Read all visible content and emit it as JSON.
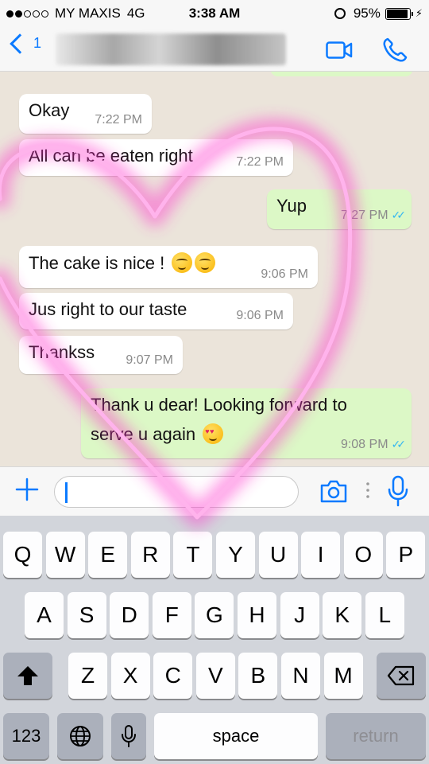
{
  "status_bar": {
    "carrier": "MY MAXIS",
    "network": "4G",
    "time": "3:38 AM",
    "battery_text": "95%",
    "battery_level": 0.95
  },
  "header": {
    "back_count": "1",
    "accent_color": "#0b7aff"
  },
  "messages": [
    {
      "dir": "in",
      "text": "Okay",
      "time": "7:22 PM"
    },
    {
      "dir": "in",
      "text": "All can be eaten right",
      "time": "7:22 PM"
    },
    {
      "dir": "out",
      "text": "Yup",
      "time": "7:27 PM"
    },
    {
      "dir": "in",
      "text": "The cake is nice !",
      "time": "9:06 PM"
    },
    {
      "dir": "in",
      "text": "Jus right to our taste",
      "time": "9:06 PM"
    },
    {
      "dir": "in",
      "text": "Thankss",
      "time": "9:07 PM"
    },
    {
      "dir": "out",
      "text_line1": "Thank u dear! Looking forward to",
      "text_line2": "serve u again",
      "time": "9:08 PM"
    }
  ],
  "icons": {
    "read_receipt": "double-check-icon",
    "emoji_yum": "savoring-food-emoji",
    "emoji_love": "heart-eyes-emoji"
  },
  "colors": {
    "outgoing_bubble": "#dcf8c6",
    "incoming_bubble": "#ffffff",
    "read_tick": "#34b7f1",
    "heart_drawing": "#ff33cc"
  },
  "input_bar": {
    "placeholder": ""
  },
  "keyboard": {
    "row1": [
      "Q",
      "W",
      "E",
      "R",
      "T",
      "Y",
      "U",
      "I",
      "O",
      "P"
    ],
    "row2": [
      "A",
      "S",
      "D",
      "F",
      "G",
      "H",
      "J",
      "K",
      "L"
    ],
    "row3": [
      "Z",
      "X",
      "C",
      "V",
      "B",
      "N",
      "M"
    ],
    "numbers_label": "123",
    "space_label": "space",
    "return_label": "return"
  }
}
